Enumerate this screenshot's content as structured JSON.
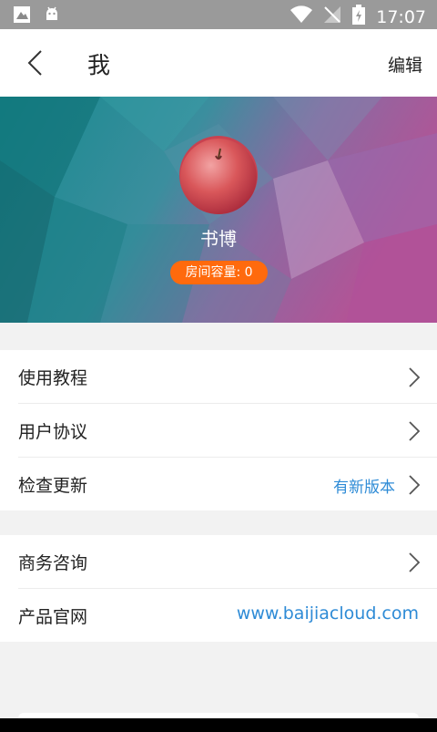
{
  "status_bar": {
    "time": "17:07"
  },
  "header": {
    "title": "我",
    "edit_label": "编辑"
  },
  "profile": {
    "name": "书博",
    "capacity_label": "房间容量: 0"
  },
  "menu_group1": [
    {
      "label": "使用教程",
      "value": ""
    },
    {
      "label": "用户协议",
      "value": ""
    },
    {
      "label": "检查更新",
      "value": "有新版本"
    }
  ],
  "menu_group2": [
    {
      "label": "商务咨询",
      "value": ""
    },
    {
      "label": "产品官网",
      "value": "www.baijiacloud.com"
    }
  ],
  "colors": {
    "accent": "#ff6a0d",
    "link": "#2e8bd6",
    "hero_teal": "#1d8a90",
    "hero_purple": "#a85a9c"
  }
}
